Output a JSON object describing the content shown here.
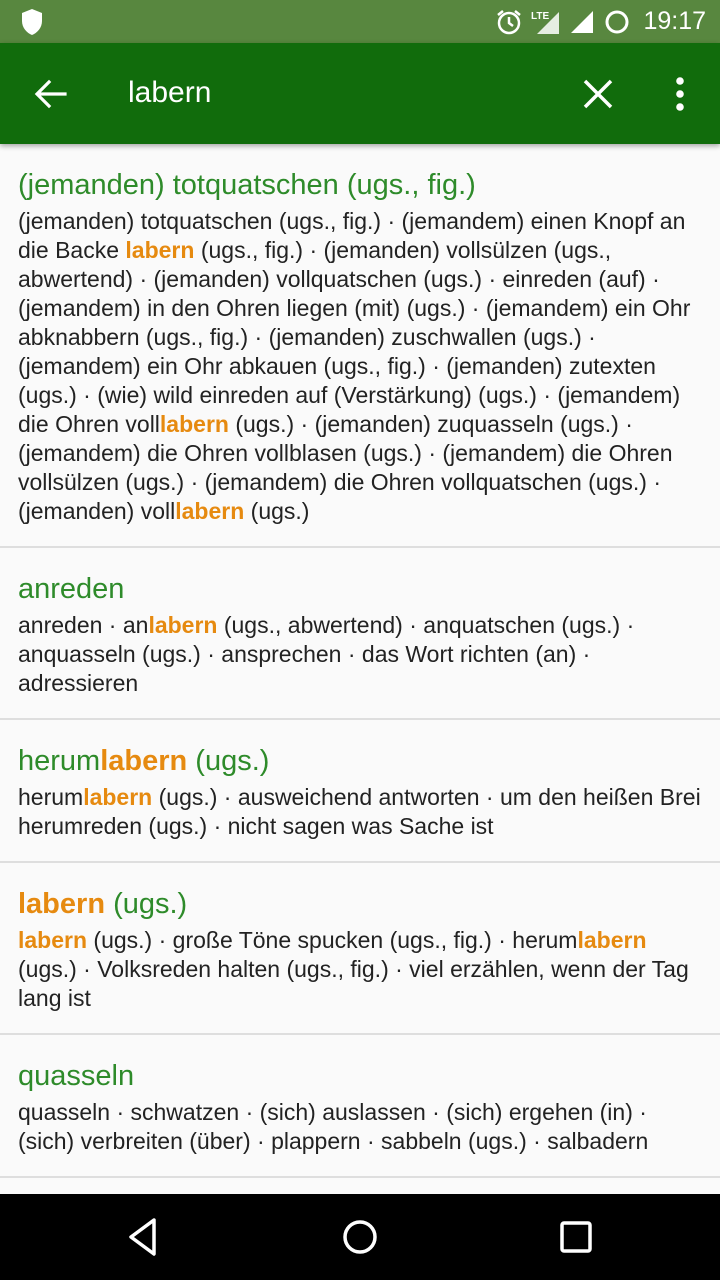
{
  "status_bar": {
    "time": "19:17",
    "network": "LTE"
  },
  "search": {
    "query": "labern",
    "placeholder": ""
  },
  "entries": [
    {
      "title": [
        "(jemanden) totquatschen (ugs., fig.)"
      ],
      "body": [
        "(jemanden) totquatschen (ugs., fig.) · (jemandem) einen Knopf an die Backe ",
        "labern",
        " (ugs., fig.) · (jemanden) vollsülzen (ugs., abwertend) · (jemanden) vollquatschen (ugs.) · einreden (auf) · (jemandem) in den Ohren liegen (mit) (ugs.) · (jemandem) ein Ohr abknabbern (ugs., fig.) · (jemanden) zuschwallen (ugs.) · (jemandem) ein Ohr abkauen (ugs., fig.) · (jemanden) zutexten (ugs.) · (wie) wild einreden auf (Verstärkung) (ugs.) · (jemandem) die Ohren voll",
        "labern",
        " (ugs.) · (jemanden) zuquasseln (ugs.) · (jemandem) die Ohren vollblasen (ugs.) · (jemandem) die Ohren vollsülzen (ugs.) · (jemandem) die Ohren vollquatschen (ugs.) · (jemanden) voll",
        "labern",
        " (ugs.)"
      ]
    },
    {
      "title": [
        "anreden"
      ],
      "body": [
        "anreden · an",
        "labern",
        " (ugs., abwertend) · anquatschen (ugs.) · anquasseln (ugs.) · ansprechen · das Wort richten (an) · adressieren"
      ]
    },
    {
      "title": [
        "herum",
        "labern",
        " (ugs.)"
      ],
      "body": [
        "herum",
        "labern",
        " (ugs.) · ausweichend antworten · um den heißen Brei herumreden (ugs.) · nicht sagen was Sache ist"
      ]
    },
    {
      "title": [
        "",
        "labern",
        " (ugs.)"
      ],
      "body": [
        "",
        "labern",
        " (ugs.) · große Töne spucken (ugs., fig.) · herum",
        "labern",
        " (ugs.) · Volksreden halten (ugs., fig.) · viel erzählen, wenn der Tag lang ist"
      ]
    },
    {
      "title": [
        "quasseln"
      ],
      "body": [
        "quasseln · schwatzen · (sich) auslassen · (sich) ergehen (in) · (sich) verbreiten (über) · plappern · sabbeln (ugs.) · salbadern"
      ]
    }
  ],
  "colors": {
    "status_bar": "#58873f",
    "app_bar": "#116c0c",
    "title_green": "#2e8b2a",
    "highlight_orange": "#e68a10"
  },
  "icons": {
    "status": [
      "shield-icon",
      "alarm-icon",
      "lte-icon",
      "signal-icon",
      "sync-icon"
    ],
    "app_bar": [
      "back-arrow-icon",
      "close-icon",
      "more-vert-icon"
    ],
    "nav": [
      "back-triangle-icon",
      "home-circle-icon",
      "recents-square-icon"
    ]
  }
}
